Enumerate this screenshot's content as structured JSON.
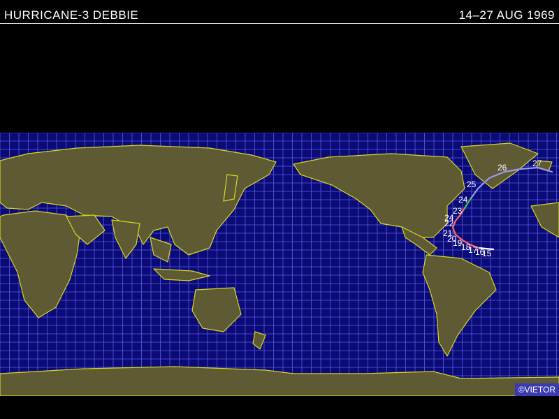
{
  "header": {
    "title": "HURRICANE-3 DEBBIE",
    "date": "14–27 AUG 1969"
  },
  "credit": "©VIETOR",
  "colors": {
    "background": "#000000",
    "ocean": "#0b0b78",
    "grid": "#5a5ae0",
    "land": "#5e5a33",
    "coast": "#d8d820",
    "track_hurricane": "#ff6a6a",
    "track_storm": "#ffffff",
    "track_extratropical": "#9a9af0",
    "track_depression": "#33cc55"
  },
  "track": {
    "day_labels": [
      "15",
      "16",
      "17",
      "18",
      "19",
      "20",
      "21",
      "22",
      "23",
      "24",
      "24",
      "25",
      "26",
      "27"
    ],
    "legend_note": ""
  }
}
